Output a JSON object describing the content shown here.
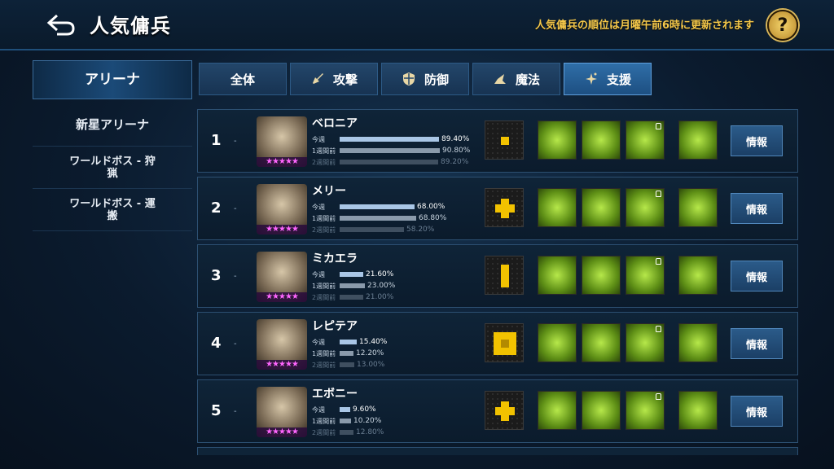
{
  "header": {
    "title": "人気傭兵",
    "update_note": "人気傭兵の順位は月曜午前6時に更新されます",
    "help_label": "?"
  },
  "sidebar": {
    "items": [
      {
        "label": "アリーナ",
        "active": true
      },
      {
        "label": "新星アリーナ",
        "active": false
      },
      {
        "label": "ワールドボス - 狩猟",
        "active": false
      },
      {
        "label": "ワールドボス - 運搬",
        "active": false
      }
    ]
  },
  "tabs": [
    {
      "label": "全体",
      "icon": "",
      "active": false
    },
    {
      "label": "攻撃",
      "icon": "sword-icon",
      "active": false
    },
    {
      "label": "防御",
      "icon": "shield-icon",
      "active": false
    },
    {
      "label": "魔法",
      "icon": "wizard-hat-icon",
      "active": false
    },
    {
      "label": "支援",
      "icon": "sparkle-icon",
      "active": true
    }
  ],
  "stat_labels": {
    "this_week": "今週",
    "one_week_ago": "1週間前",
    "two_weeks_ago": "2週間前"
  },
  "info_label": "情報",
  "rows": [
    {
      "rank": "1",
      "name": "ベロニア",
      "stars": "★★★★★",
      "this_week": "89.40%",
      "one_week_ago": "90.80%",
      "two_weeks_ago": "89.20%",
      "this_week_frac": 0.894,
      "one_week_frac": 0.908,
      "two_week_frac": 0.892
    },
    {
      "rank": "2",
      "name": "メリー",
      "stars": "★★★★★",
      "this_week": "68.00%",
      "one_week_ago": "68.80%",
      "two_weeks_ago": "58.20%",
      "this_week_frac": 0.68,
      "one_week_frac": 0.688,
      "two_week_frac": 0.582
    },
    {
      "rank": "3",
      "name": "ミカエラ",
      "stars": "★★★★★",
      "this_week": "21.60%",
      "one_week_ago": "23.00%",
      "two_weeks_ago": "21.00%",
      "this_week_frac": 0.216,
      "one_week_frac": 0.23,
      "two_week_frac": 0.21
    },
    {
      "rank": "4",
      "name": "レピテア",
      "stars": "★★★★★",
      "this_week": "15.40%",
      "one_week_ago": "12.20%",
      "two_weeks_ago": "13.00%",
      "this_week_frac": 0.154,
      "one_week_frac": 0.122,
      "two_week_frac": 0.13
    },
    {
      "rank": "5",
      "name": "エボニー",
      "stars": "★★★★★",
      "this_week": "9.60%",
      "one_week_ago": "10.20%",
      "two_weeks_ago": "12.80%",
      "this_week_frac": 0.096,
      "one_week_frac": 0.102,
      "two_week_frac": 0.128
    }
  ],
  "colors": {
    "accent_gold": "#f5c84a",
    "bar_this_week": "#a9c6e6",
    "bar_past": "#8a9aab",
    "skill_green": "#8ec62e"
  }
}
